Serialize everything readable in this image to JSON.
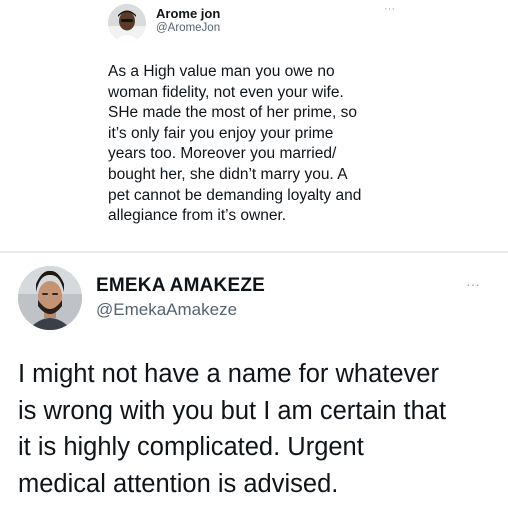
{
  "tweet_top": {
    "author_name": "Arome jon",
    "author_handle": "@AromeJon",
    "more_icon": "ellipsis-icon",
    "more_label": "···",
    "text_lines": [
      "As a High value man you owe no",
      "woman fidelity, not even your wife.",
      "SHe made the most of her prime, so",
      "it’s only fair you enjoy your prime",
      "years too. Moreover you married/",
      "bought her, she didn’t marry you. A",
      "pet cannot be demanding loyalty and",
      "allegiance from it’s owner."
    ]
  },
  "tweet_main": {
    "author_name": "EMEKA AMAKEZE",
    "author_handle": "@EmekaAmakeze",
    "more_icon": "ellipsis-icon",
    "more_label": "···",
    "text_lines": [
      "I might not have a name for whatever",
      "is wrong with you but I am certain that",
      "it is highly complicated. Urgent",
      "medical attention is advised."
    ]
  },
  "colors": {
    "text_primary": "#0f1419",
    "text_secondary": "#536471",
    "divider": "#e6ecf0",
    "background": "#ffffff"
  }
}
